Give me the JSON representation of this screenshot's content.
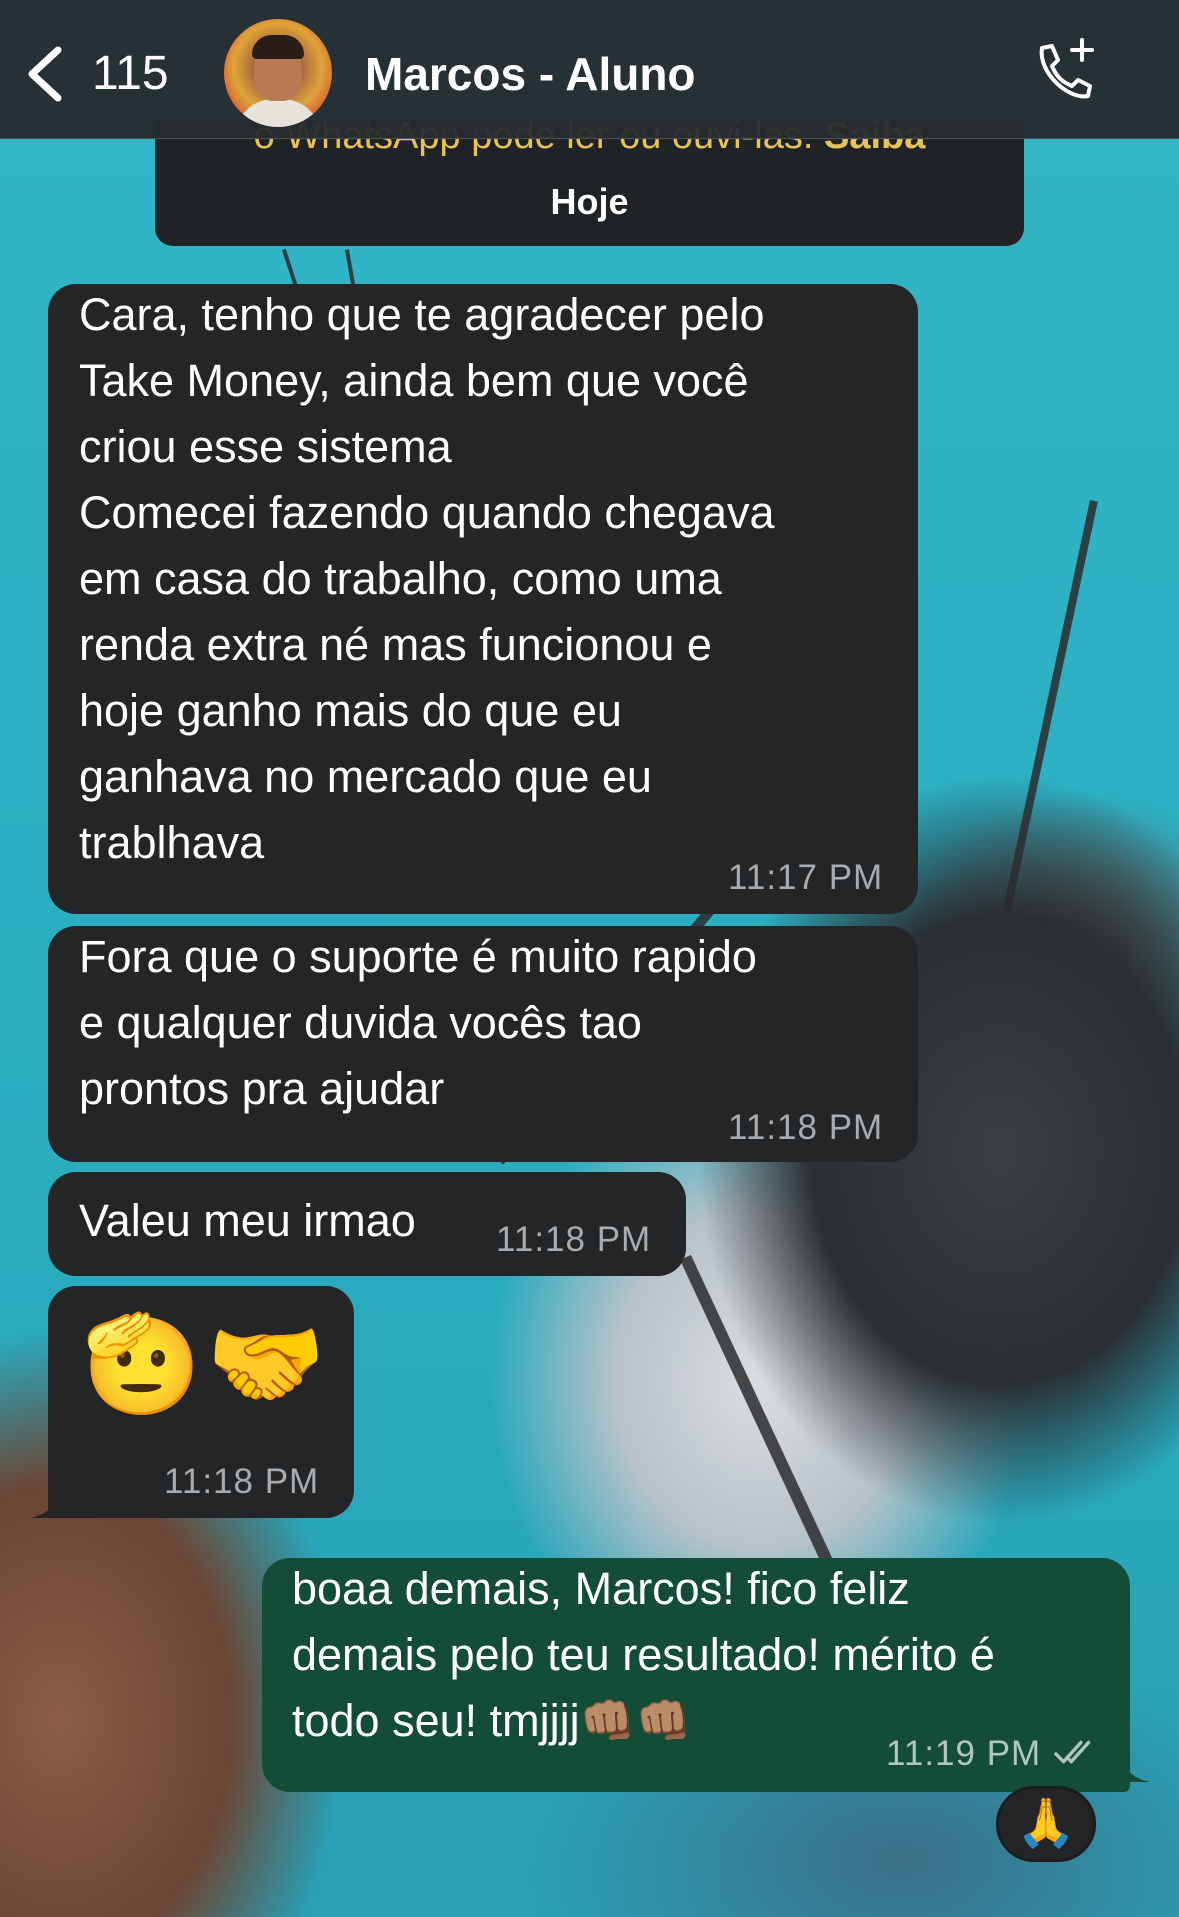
{
  "header": {
    "back_count": "115",
    "contact_name": "Marcos - Aluno"
  },
  "notice": {
    "text": "o WhatsApp pode ler ou ouvi-las.",
    "link": "Saiba",
    "date": "Hoje"
  },
  "messages": [
    {
      "direction": "incoming",
      "text": "Cara, tenho que te agradecer pelo\nTake Money, ainda bem que você\ncriou esse sistema\nComecei fazendo quando chegava\nem casa do trabalho, como uma\nrenda extra né mas funcionou e\nhoje ganho mais do que eu\nganhava no mercado que eu\ntrablhava",
      "time": "11:17 PM"
    },
    {
      "direction": "incoming",
      "text": "Fora que o suporte é muito rapido\ne qualquer duvida vocês tao\nprontos pra ajudar",
      "time": "11:18 PM"
    },
    {
      "direction": "incoming",
      "text": "Valeu meu irmao",
      "time": "11:18 PM"
    },
    {
      "direction": "incoming",
      "emojis": [
        "🫡",
        "🤝"
      ],
      "time": "11:18 PM"
    },
    {
      "direction": "outgoing",
      "text": "boaa demais, Marcos! fico feliz\ndemais pelo teu resultado! mérito é\ntodo seu! tmjjjj👊🏽👊🏽",
      "time": "11:19 PM",
      "status": "read"
    }
  ],
  "reaction": "🙏",
  "icons": {
    "back": "chevron-left-icon",
    "call": "phone-add-icon",
    "read_receipt": "double-check-icon"
  },
  "colors": {
    "incoming_bubble": "#232527",
    "outgoing_bubble": "#144d37",
    "header": "#262c2f",
    "link": "#e7c25a"
  }
}
